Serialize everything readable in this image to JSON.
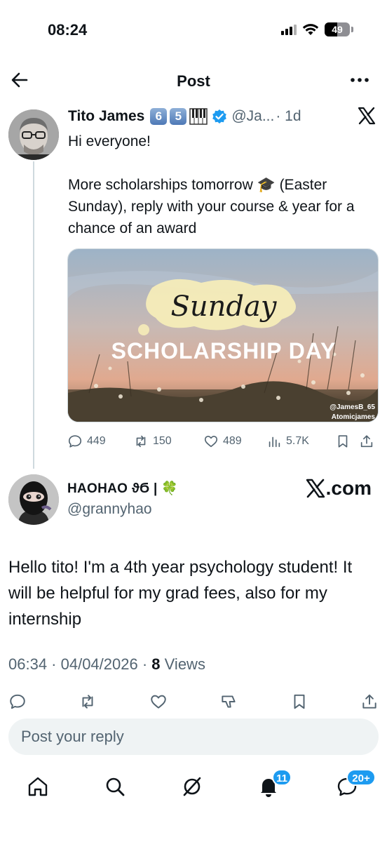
{
  "status_bar": {
    "time": "08:24",
    "battery_level": "49"
  },
  "header": {
    "title": "Post",
    "back_icon": "arrow-left-icon",
    "more_icon": "more-horizontal-icon"
  },
  "original_tweet": {
    "author_name": "Tito James",
    "badges": [
      "6",
      "5"
    ],
    "handle": "@Ja...",
    "time_ago": "· 1d",
    "line1": "Hi everyone!",
    "line2": "More scholarships tomorrow 🎓 (Easter Sunday), reply with your course & year for a chance of an award",
    "image": {
      "script_title": "Sunday",
      "banner": "SCHOLARSHIP DAY",
      "credit1": "@JamesB_65",
      "credit2": "Atomicjames"
    },
    "stats": {
      "replies": "449",
      "reposts": "150",
      "likes": "489",
      "views": "5.7K"
    }
  },
  "reply": {
    "author_name": "HAOHAO ϑϬ | 🍀",
    "handle": "@grannyhao",
    "brand": ".com",
    "text": "Hello tito! I'm a 4th year psychology student! It will be helpful for my grad fees, also for my internship",
    "time": "06:34 · 04/04/2026 ·",
    "views_count": "8",
    "views_label": "Views"
  },
  "compose": {
    "placeholder": "Post your reply"
  },
  "tab_bar": {
    "notifications_badge": "11",
    "messages_badge": "20+"
  },
  "colors": {
    "accent": "#1d9bf0",
    "text_secondary": "#536471",
    "divider": "#cfd9de"
  }
}
